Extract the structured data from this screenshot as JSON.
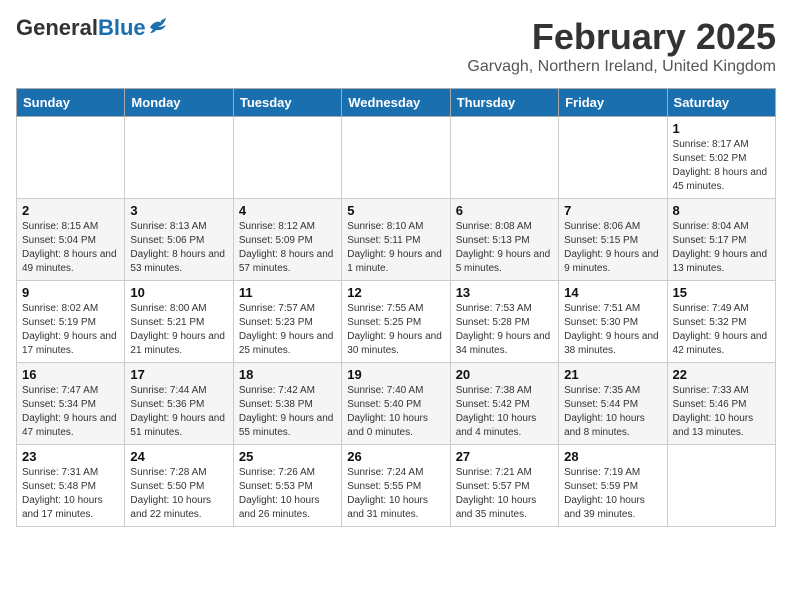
{
  "header": {
    "logo_general": "General",
    "logo_blue": "Blue",
    "month_title": "February 2025",
    "location": "Garvagh, Northern Ireland, United Kingdom"
  },
  "weekdays": [
    "Sunday",
    "Monday",
    "Tuesday",
    "Wednesday",
    "Thursday",
    "Friday",
    "Saturday"
  ],
  "weeks": [
    [
      {
        "day": "",
        "info": ""
      },
      {
        "day": "",
        "info": ""
      },
      {
        "day": "",
        "info": ""
      },
      {
        "day": "",
        "info": ""
      },
      {
        "day": "",
        "info": ""
      },
      {
        "day": "",
        "info": ""
      },
      {
        "day": "1",
        "info": "Sunrise: 8:17 AM\nSunset: 5:02 PM\nDaylight: 8 hours and 45 minutes."
      }
    ],
    [
      {
        "day": "2",
        "info": "Sunrise: 8:15 AM\nSunset: 5:04 PM\nDaylight: 8 hours and 49 minutes."
      },
      {
        "day": "3",
        "info": "Sunrise: 8:13 AM\nSunset: 5:06 PM\nDaylight: 8 hours and 53 minutes."
      },
      {
        "day": "4",
        "info": "Sunrise: 8:12 AM\nSunset: 5:09 PM\nDaylight: 8 hours and 57 minutes."
      },
      {
        "day": "5",
        "info": "Sunrise: 8:10 AM\nSunset: 5:11 PM\nDaylight: 9 hours and 1 minute."
      },
      {
        "day": "6",
        "info": "Sunrise: 8:08 AM\nSunset: 5:13 PM\nDaylight: 9 hours and 5 minutes."
      },
      {
        "day": "7",
        "info": "Sunrise: 8:06 AM\nSunset: 5:15 PM\nDaylight: 9 hours and 9 minutes."
      },
      {
        "day": "8",
        "info": "Sunrise: 8:04 AM\nSunset: 5:17 PM\nDaylight: 9 hours and 13 minutes."
      }
    ],
    [
      {
        "day": "9",
        "info": "Sunrise: 8:02 AM\nSunset: 5:19 PM\nDaylight: 9 hours and 17 minutes."
      },
      {
        "day": "10",
        "info": "Sunrise: 8:00 AM\nSunset: 5:21 PM\nDaylight: 9 hours and 21 minutes."
      },
      {
        "day": "11",
        "info": "Sunrise: 7:57 AM\nSunset: 5:23 PM\nDaylight: 9 hours and 25 minutes."
      },
      {
        "day": "12",
        "info": "Sunrise: 7:55 AM\nSunset: 5:25 PM\nDaylight: 9 hours and 30 minutes."
      },
      {
        "day": "13",
        "info": "Sunrise: 7:53 AM\nSunset: 5:28 PM\nDaylight: 9 hours and 34 minutes."
      },
      {
        "day": "14",
        "info": "Sunrise: 7:51 AM\nSunset: 5:30 PM\nDaylight: 9 hours and 38 minutes."
      },
      {
        "day": "15",
        "info": "Sunrise: 7:49 AM\nSunset: 5:32 PM\nDaylight: 9 hours and 42 minutes."
      }
    ],
    [
      {
        "day": "16",
        "info": "Sunrise: 7:47 AM\nSunset: 5:34 PM\nDaylight: 9 hours and 47 minutes."
      },
      {
        "day": "17",
        "info": "Sunrise: 7:44 AM\nSunset: 5:36 PM\nDaylight: 9 hours and 51 minutes."
      },
      {
        "day": "18",
        "info": "Sunrise: 7:42 AM\nSunset: 5:38 PM\nDaylight: 9 hours and 55 minutes."
      },
      {
        "day": "19",
        "info": "Sunrise: 7:40 AM\nSunset: 5:40 PM\nDaylight: 10 hours and 0 minutes."
      },
      {
        "day": "20",
        "info": "Sunrise: 7:38 AM\nSunset: 5:42 PM\nDaylight: 10 hours and 4 minutes."
      },
      {
        "day": "21",
        "info": "Sunrise: 7:35 AM\nSunset: 5:44 PM\nDaylight: 10 hours and 8 minutes."
      },
      {
        "day": "22",
        "info": "Sunrise: 7:33 AM\nSunset: 5:46 PM\nDaylight: 10 hours and 13 minutes."
      }
    ],
    [
      {
        "day": "23",
        "info": "Sunrise: 7:31 AM\nSunset: 5:48 PM\nDaylight: 10 hours and 17 minutes."
      },
      {
        "day": "24",
        "info": "Sunrise: 7:28 AM\nSunset: 5:50 PM\nDaylight: 10 hours and 22 minutes."
      },
      {
        "day": "25",
        "info": "Sunrise: 7:26 AM\nSunset: 5:53 PM\nDaylight: 10 hours and 26 minutes."
      },
      {
        "day": "26",
        "info": "Sunrise: 7:24 AM\nSunset: 5:55 PM\nDaylight: 10 hours and 31 minutes."
      },
      {
        "day": "27",
        "info": "Sunrise: 7:21 AM\nSunset: 5:57 PM\nDaylight: 10 hours and 35 minutes."
      },
      {
        "day": "28",
        "info": "Sunrise: 7:19 AM\nSunset: 5:59 PM\nDaylight: 10 hours and 39 minutes."
      },
      {
        "day": "",
        "info": ""
      }
    ]
  ]
}
